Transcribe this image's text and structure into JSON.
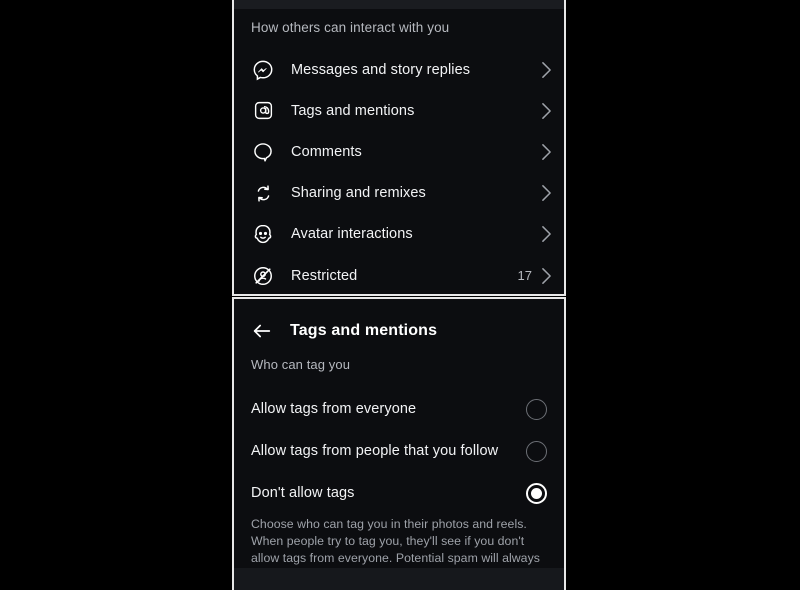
{
  "top_panel": {
    "section_title": "How others can interact with you",
    "rows": [
      {
        "icon": "messenger-icon",
        "label": "Messages and story replies",
        "count": ""
      },
      {
        "icon": "at-mention-icon",
        "label": "Tags and mentions",
        "count": ""
      },
      {
        "icon": "comment-icon",
        "label": "Comments",
        "count": ""
      },
      {
        "icon": "share-remix-icon",
        "label": "Sharing and remixes",
        "count": ""
      },
      {
        "icon": "avatar-face-icon",
        "label": "Avatar interactions",
        "count": ""
      },
      {
        "icon": "restricted-icon",
        "label": "Restricted",
        "count": "17"
      }
    ]
  },
  "bottom_panel": {
    "back_label": "Back",
    "title": "Tags and mentions",
    "section_title": "Who can tag you",
    "options": [
      {
        "label": "Allow tags from everyone",
        "selected": false
      },
      {
        "label": "Allow tags from people that you follow",
        "selected": false
      },
      {
        "label": "Don't allow tags",
        "selected": true
      }
    ],
    "description": "Choose who can tag you in their photos and reels. When people try to tag you, they'll see if you don't allow tags from everyone. Potential spam will always be filtered."
  },
  "colors": {
    "background": "#000000",
    "panel": "#0c0d10",
    "panel_border": "#e8e8e8",
    "primary_text": "#f2f3f5",
    "secondary_text": "#b6b9bf",
    "muted_text": "#9ea2a9",
    "radio_selected": "#ffffff",
    "radio_unselected": "#6d7076"
  }
}
